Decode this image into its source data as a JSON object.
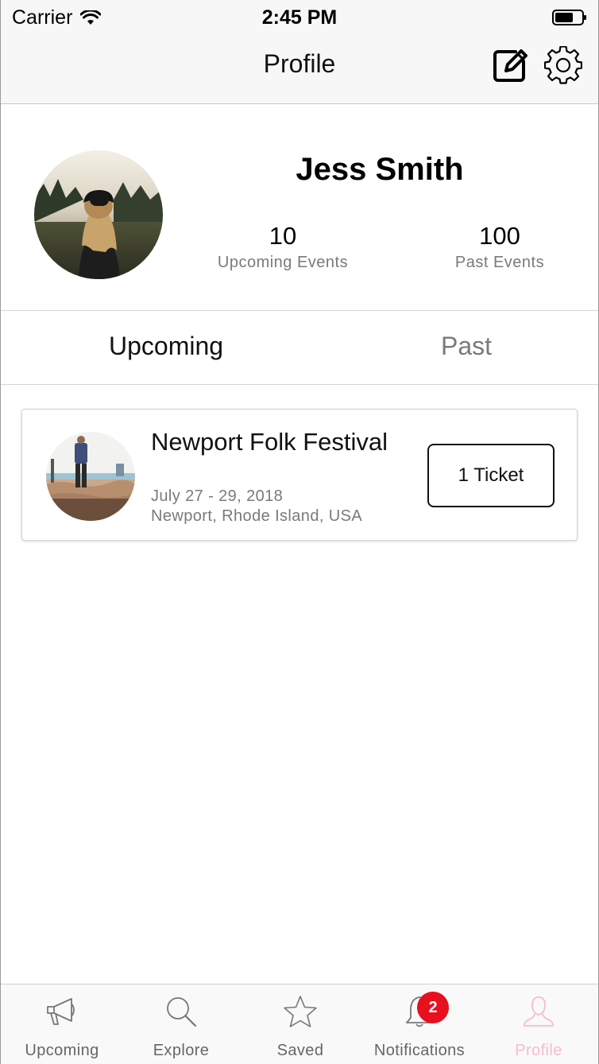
{
  "status_bar": {
    "carrier": "Carrier",
    "time": "2:45 PM"
  },
  "nav": {
    "title": "Profile"
  },
  "profile": {
    "name": "Jess Smith",
    "upcoming_count": "10",
    "upcoming_label": "Upcoming Events",
    "past_count": "100",
    "past_label": "Past Events"
  },
  "tabs": {
    "upcoming": "Upcoming",
    "past": "Past",
    "selected": "Upcoming"
  },
  "events": [
    {
      "title": "Newport Folk Festival",
      "date": "July 27 - 29, 2018",
      "location": "Newport, Rhode Island, USA",
      "ticket_label": "1 Ticket"
    }
  ],
  "tabbar": {
    "items": [
      {
        "label": "Upcoming",
        "icon": "megaphone-icon"
      },
      {
        "label": "Explore",
        "icon": "search-icon"
      },
      {
        "label": "Saved",
        "icon": "star-icon"
      },
      {
        "label": "Notifications",
        "icon": "bell-icon"
      },
      {
        "label": "Profile",
        "icon": "person-icon"
      }
    ],
    "notifications_badge": "2",
    "active_color": "#f6bdc8"
  },
  "colors": {
    "badge": "#e8101e",
    "muted_text": "#7a7a7a"
  }
}
